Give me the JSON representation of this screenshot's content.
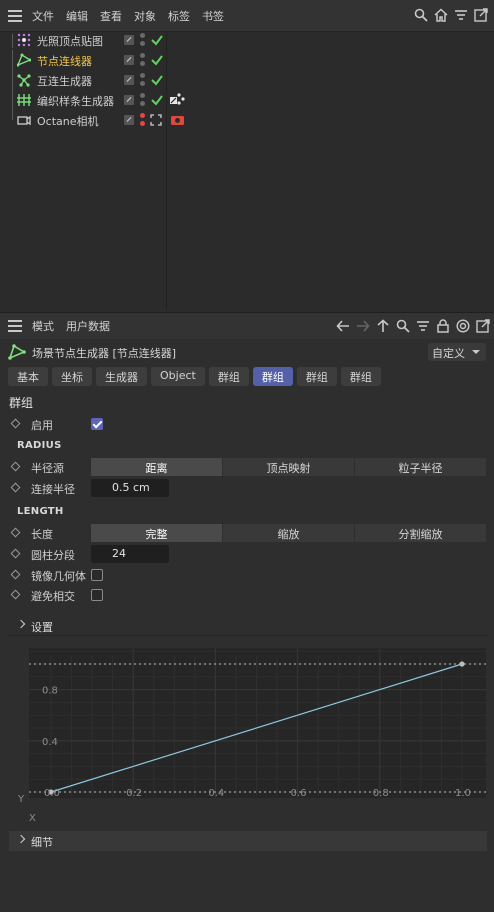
{
  "object_manager": {
    "menu": [
      "文件",
      "编辑",
      "查看",
      "对象",
      "标签",
      "书签"
    ],
    "objects": [
      {
        "name": "光照顶点贴图",
        "selected": false,
        "icon": "grid-dots-icon",
        "color": "#c080f0"
      },
      {
        "name": "节点连线器",
        "selected": true,
        "icon": "node-connector-icon",
        "color": "#7ee07e"
      },
      {
        "name": "互连生成器",
        "selected": false,
        "icon": "interconnect-icon",
        "color": "#7ee07e"
      },
      {
        "name": "编织样条生成器",
        "selected": false,
        "icon": "weave-spline-icon",
        "color": "#7ee07e"
      },
      {
        "name": "Octane相机",
        "selected": false,
        "icon": "camera-icon",
        "color": "#d0d0d0"
      }
    ]
  },
  "attribute_manager": {
    "menu": [
      "模式",
      "用户数据"
    ],
    "object_title": "场景节点生成器 [节点连线器]",
    "custom_dropdown": "自定义",
    "tabs": [
      {
        "label": "基本",
        "active": false
      },
      {
        "label": "坐标",
        "active": false
      },
      {
        "label": "生成器",
        "active": false
      },
      {
        "label": "Object",
        "active": false
      },
      {
        "label": "群组",
        "active": false
      },
      {
        "label": "群组",
        "active": true
      },
      {
        "label": "群组",
        "active": false
      },
      {
        "label": "群组",
        "active": false
      }
    ],
    "section_title": "群组",
    "enable": {
      "label": "启用",
      "checked": true
    },
    "radius_header": "RADIUS",
    "radius_source": {
      "label": "半径源",
      "options": [
        "距离",
        "顶点映射",
        "粒子半径"
      ],
      "selected": 0
    },
    "connect_radius": {
      "label": "连接半径",
      "value": "0.5 cm"
    },
    "length_header": "LENGTH",
    "length": {
      "label": "长度",
      "options": [
        "完整",
        "缩放",
        "分割缩放"
      ],
      "selected": 0
    },
    "cyl_segments": {
      "label": "圆柱分段",
      "value": "24"
    },
    "mirror_geometry": {
      "label": "镜像几何体",
      "checked": false
    },
    "avoid_intersect": {
      "label": "避免相交",
      "checked": false
    },
    "settings_label": "设置",
    "details_label": "细节",
    "graph": {
      "x_label": "X",
      "y_label": "Y",
      "x_ticks": [
        "0.0",
        "0.2",
        "0.4",
        "0.6",
        "0.8",
        "1.0"
      ],
      "y_ticks": [
        "0.4",
        "0.8"
      ],
      "curve_points": [
        [
          0,
          0
        ],
        [
          1,
          1
        ]
      ]
    }
  },
  "colors": {
    "accent": "#5460a8",
    "selected_text": "#f0c64a",
    "check_green": "#5fd35f",
    "curve": "#8cc8e0",
    "red_dot": "#e04848"
  }
}
